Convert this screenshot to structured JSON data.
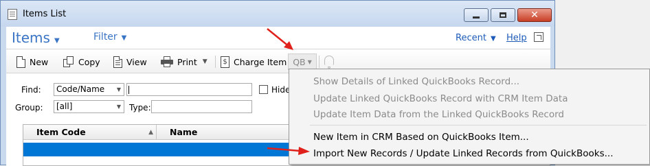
{
  "window": {
    "title": "Items List"
  },
  "header": {
    "title": "Items",
    "filter_label": "Filter",
    "recent_label": "Recent",
    "help_label": "Help"
  },
  "toolbar": {
    "new_label": "New",
    "copy_label": "Copy",
    "view_label": "View",
    "print_label": "Print",
    "charge_item_label": "Charge Item",
    "qb_label": "QB",
    "charge_icon_glyph": "$"
  },
  "find": {
    "find_label": "Find:",
    "field_value": "Code/Name",
    "hide_label": "Hide",
    "group_label": "Group:",
    "group_value": "[all]",
    "type_label": "Type:"
  },
  "grid": {
    "columns": [
      "Item Code",
      "Name"
    ]
  },
  "qb_menu": {
    "items": [
      {
        "label": "Show Details of Linked QuickBooks Record...",
        "enabled": false
      },
      {
        "label": "Update Linked QuickBooks Record with CRM Item Data",
        "enabled": false
      },
      {
        "label": "Update Item Data from the Linked QuickBooks Record",
        "enabled": false
      },
      {
        "label": "New Item in CRM Based on QuickBooks Item...",
        "enabled": true
      },
      {
        "label": "Import New Records / Update Linked Records from QuickBooks...",
        "enabled": true
      }
    ]
  },
  "colors": {
    "accent": "#3a74c4",
    "link": "#1e5bb8",
    "selection": "#0077d4",
    "annotation_arrow": "#e0201a",
    "disabled_text": "#8b8b8b"
  },
  "icons": [
    "new-document-icon",
    "copy-icon",
    "view-icon",
    "print-icon",
    "charge-item-icon",
    "bell-icon",
    "popout-icon"
  ]
}
